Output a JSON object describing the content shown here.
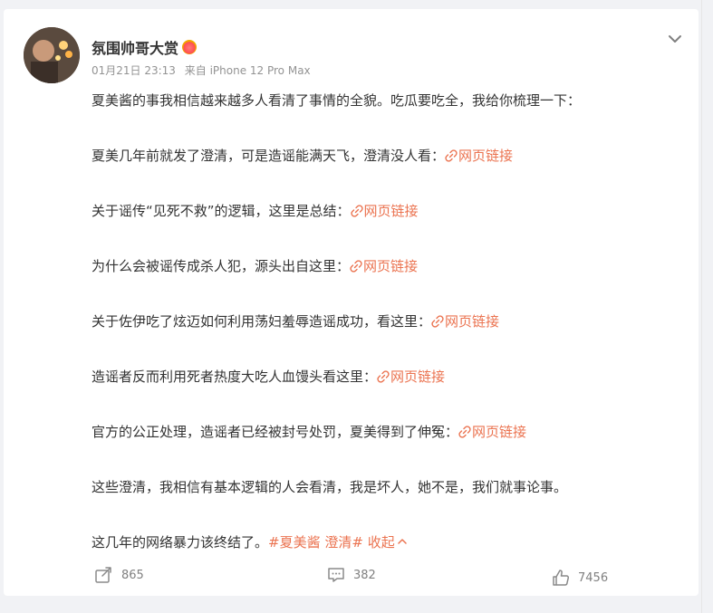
{
  "post": {
    "username": "氛围帅哥大赏",
    "badge_icon": "vip-heart-badge-icon",
    "date": "01月21日 23:13",
    "source": "来自 iPhone 12 Pro Max",
    "intro": "夏美酱的事我相信越来越多人看清了事情的全貌。吃瓜要吃全，我给你梳理一下：",
    "items": [
      {
        "text": "夏美几年前就发了澄清，可是造谣能满天飞，澄清没人看：",
        "link": "网页链接"
      },
      {
        "text": "关于谣传“见死不救”的逻辑，这里是总结：",
        "link": "网页链接"
      },
      {
        "text": "为什么会被谣传成杀人犯，源头出自这里：",
        "link": "网页链接"
      },
      {
        "text": "关于佐伊吃了炫迈如何利用荡妇羞辱造谣成功，看这里：",
        "link": "网页链接"
      },
      {
        "text": "造谣者反而利用死者热度大吃人血馒头看这里：",
        "link": "网页链接"
      },
      {
        "text": "官方的公正处理，造谣者已经被封号处罚，夏美得到了伸冤：",
        "link": "网页链接"
      }
    ],
    "closing": "这些澄清，我相信有基本逻辑的人会看清，我是坏人，她不是，我们就事论事。",
    "final_text": "这几年的网络暴力该终结了。",
    "tags": "#夏美酱 澄清#",
    "collapse_label": "收起"
  },
  "actions": {
    "repost_count": "865",
    "comment_count": "382",
    "like_count": "7456"
  },
  "colors": {
    "link": "#eb7350",
    "meta": "#939393",
    "text": "#333333"
  }
}
